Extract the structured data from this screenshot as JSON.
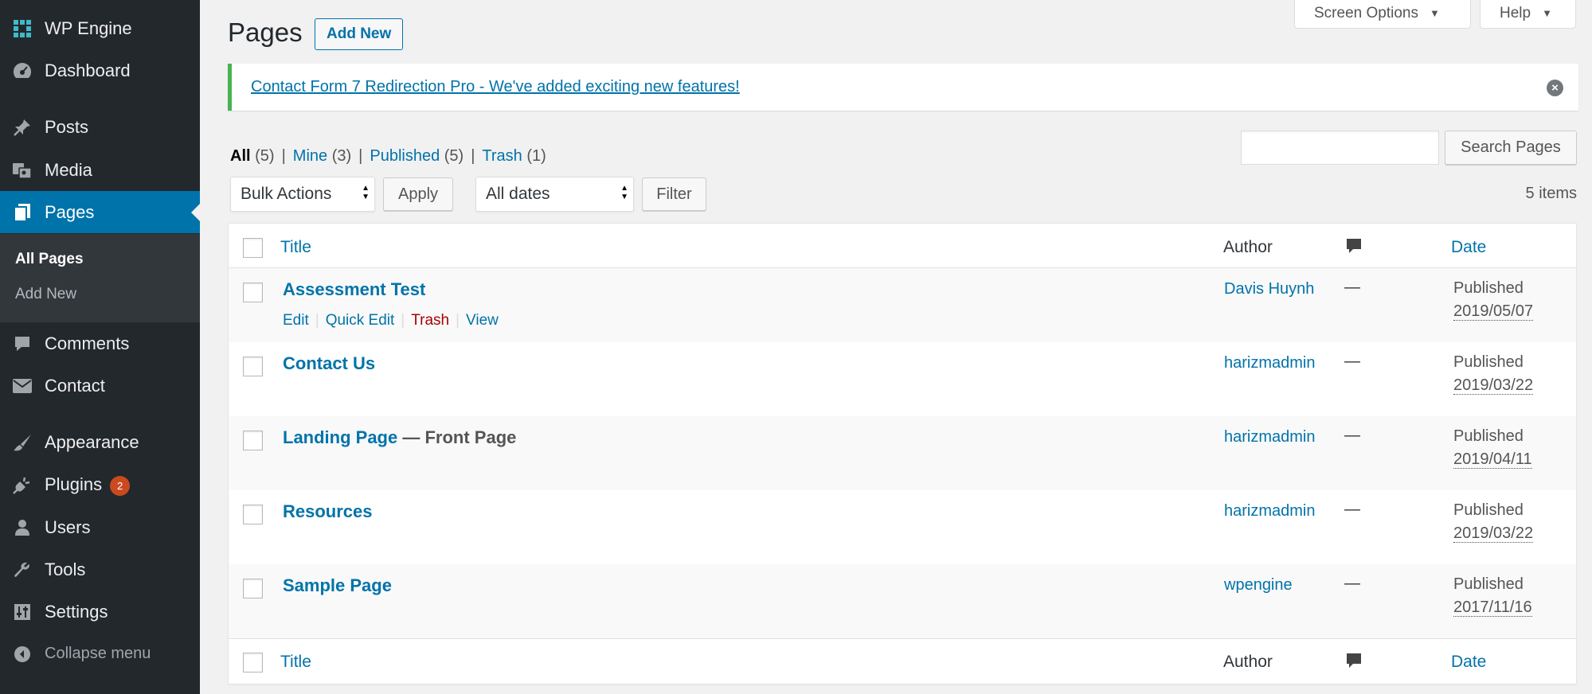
{
  "sidebar": {
    "site_name": "WP Engine",
    "items": [
      {
        "label": "Dashboard"
      },
      {
        "label": "Posts"
      },
      {
        "label": "Media"
      },
      {
        "label": "Pages"
      },
      {
        "label": "Comments"
      },
      {
        "label": "Contact"
      },
      {
        "label": "Appearance"
      },
      {
        "label": "Plugins",
        "badge": "2"
      },
      {
        "label": "Users"
      },
      {
        "label": "Tools"
      },
      {
        "label": "Settings"
      }
    ],
    "submenu": [
      {
        "label": "All Pages"
      },
      {
        "label": "Add New"
      }
    ],
    "collapse_label": "Collapse menu"
  },
  "header": {
    "screen_options": "Screen Options",
    "help": "Help",
    "title": "Pages",
    "add_new": "Add New"
  },
  "notice": {
    "text": "Contact Form 7 Redirection Pro - We've added exciting new features!"
  },
  "views": [
    {
      "label": "All",
      "count": "(5)"
    },
    {
      "label": "Mine",
      "count": "(3)"
    },
    {
      "label": "Published",
      "count": "(5)"
    },
    {
      "label": "Trash",
      "count": "(1)"
    }
  ],
  "search": {
    "value": "",
    "button": "Search Pages"
  },
  "filters": {
    "bulk_actions": "Bulk Actions",
    "apply": "Apply",
    "dates": "All dates",
    "filter": "Filter",
    "items_count": "5 items"
  },
  "table": {
    "columns": {
      "title": "Title",
      "author": "Author",
      "date": "Date"
    },
    "rows": [
      {
        "title": "Assessment Test",
        "state": "",
        "author": "Davis Huynh",
        "comments": "—",
        "status": "Published",
        "date": "2019/05/07"
      },
      {
        "title": "Contact Us",
        "state": "",
        "author": "harizmadmin",
        "comments": "—",
        "status": "Published",
        "date": "2019/03/22"
      },
      {
        "title": "Landing Page",
        "state": " — Front Page",
        "author": "harizmadmin",
        "comments": "—",
        "status": "Published",
        "date": "2019/04/11"
      },
      {
        "title": "Resources",
        "state": "",
        "author": "harizmadmin",
        "comments": "—",
        "status": "Published",
        "date": "2019/03/22"
      },
      {
        "title": "Sample Page",
        "state": "",
        "author": "wpengine",
        "comments": "—",
        "status": "Published",
        "date": "2017/11/16"
      }
    ],
    "row_actions": [
      "Edit",
      "Quick Edit",
      "Trash",
      "View"
    ]
  },
  "colors": {
    "sidebar_bg": "#23282d",
    "accent": "#0073aa",
    "notice_border": "#46b450",
    "trash": "#aa0000",
    "badge": "#ca4a1f"
  }
}
